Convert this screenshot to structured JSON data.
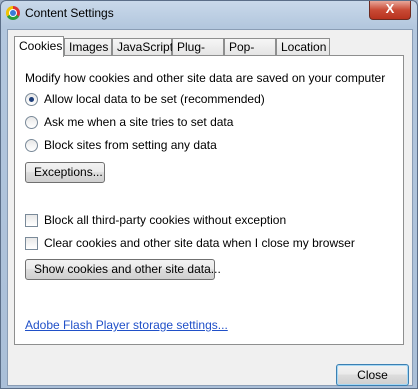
{
  "window": {
    "title": "Content Settings",
    "close_glyph": "X"
  },
  "tabs": [
    {
      "label": "Cookies",
      "active": true
    },
    {
      "label": "Images",
      "active": false
    },
    {
      "label": "JavaScript",
      "active": false
    },
    {
      "label": "Plug-ins",
      "active": false
    },
    {
      "label": "Pop-ups",
      "active": false
    },
    {
      "label": "Location",
      "active": false
    }
  ],
  "cookies": {
    "description": "Modify how cookies and other site data are saved on your computer",
    "radio_options": [
      {
        "label": "Allow local data to be set (recommended)",
        "checked": true
      },
      {
        "label": "Ask me when a site tries to set data",
        "checked": false
      },
      {
        "label": "Block sites from setting any data",
        "checked": false
      }
    ],
    "exceptions_button": "Exceptions...",
    "checkbox_options": [
      {
        "label": "Block all third-party cookies without exception",
        "checked": false
      },
      {
        "label": "Clear cookies and other site data when I close my browser",
        "checked": false
      }
    ],
    "show_cookies_button": "Show cookies and other site data...",
    "flash_link": "Adobe Flash Player storage settings..."
  },
  "footer": {
    "close_button": "Close"
  },
  "icons": {
    "app": "chrome-logo-icon",
    "window_close": "close-icon"
  }
}
